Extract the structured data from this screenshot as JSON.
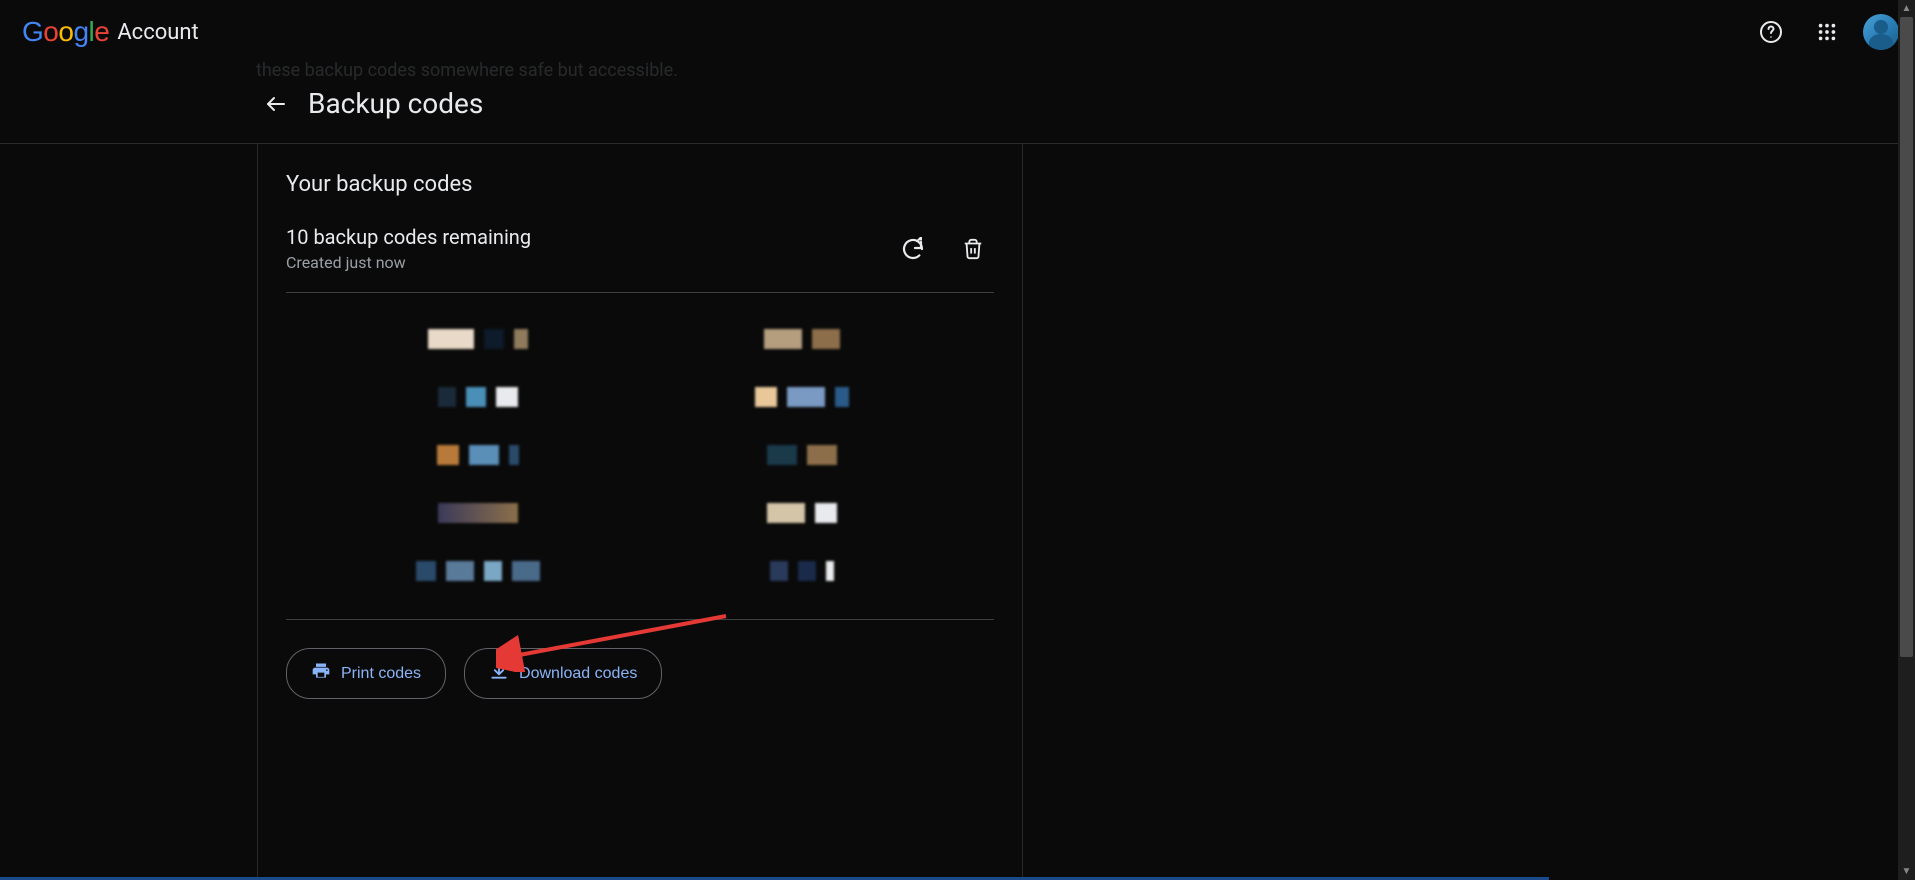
{
  "header": {
    "brand": "Google",
    "product": "Account"
  },
  "subheader": {
    "faded_intro": "these backup codes somewhere safe but accessible.",
    "title": "Backup codes"
  },
  "panel": {
    "section_title": "Your backup codes",
    "status": "10 backup codes remaining",
    "status_sub": "Created just now"
  },
  "buttons": {
    "print": "Print codes",
    "download": "Download codes"
  },
  "icons": {
    "help": "help",
    "apps": "apps",
    "back": "arrow_back",
    "refresh": "refresh",
    "delete": "delete",
    "print": "print",
    "download": "download"
  }
}
